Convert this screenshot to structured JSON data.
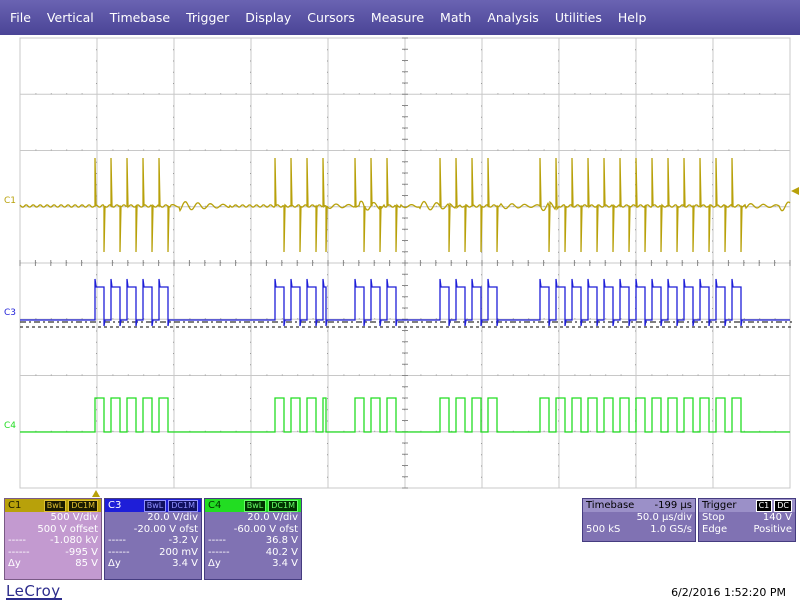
{
  "menu": [
    "File",
    "Vertical",
    "Timebase",
    "Trigger",
    "Display",
    "Cursors",
    "Measure",
    "Math",
    "Analysis",
    "Utilities",
    "Help"
  ],
  "colors": {
    "c1": "#b8a10a",
    "c3": "#1e1ed8",
    "c4": "#22dd22",
    "menubar": "#5a54a6",
    "grid": "#c8c8c8"
  },
  "channels": {
    "c1": {
      "label": "C1",
      "tags": [
        "BwL",
        "DC1M"
      ],
      "vdiv": "500 V/div",
      "offset": "500 V offset",
      "m1_key": "-----",
      "m1": "-1.080 kV",
      "m2_key": "------",
      "m2": "-995 V",
      "dy_key": "Δy",
      "dy": "85 V"
    },
    "c3": {
      "label": "C3",
      "tags": [
        "BwL",
        "DC1M"
      ],
      "vdiv": "20.0 V/div",
      "offset": "-20.00 V ofst",
      "m1_key": "-----",
      "m1": "-3.2 V",
      "m2_key": "------",
      "m2": "200 mV",
      "dy_key": "Δy",
      "dy": "3.4 V"
    },
    "c4": {
      "label": "C4",
      "tags": [
        "BwL",
        "DC1M"
      ],
      "vdiv": "20.0 V/div",
      "offset": "-60.00 V ofst",
      "m1_key": "-----",
      "m1": "36.8 V",
      "m2_key": "------",
      "m2": "40.2 V",
      "dy_key": "Δy",
      "dy": "3.4 V"
    }
  },
  "timebase": {
    "title": "Timebase",
    "delay": "-199 µs",
    "tdiv": "50.0 µs/div",
    "samples": "500 kS",
    "rate": "1.0 GS/s"
  },
  "trigger": {
    "title": "Trigger",
    "tags": [
      "C1",
      "DC"
    ],
    "mode": "Stop",
    "level": "140 V",
    "type": "Edge",
    "slope": "Positive"
  },
  "logo": "LeCroy",
  "timestamp": "6/2/2016 1:52:20 PM"
}
